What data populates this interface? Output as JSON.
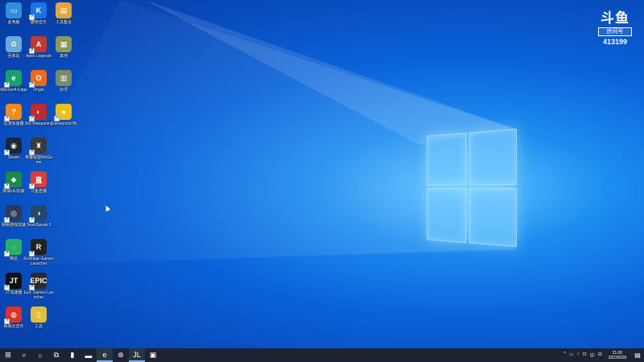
{
  "desktop": {
    "icons": [
      {
        "name": "this-pc",
        "label": "此电脑",
        "glyph": "▭",
        "color": "#2d8de0",
        "col": 0,
        "row": 0,
        "shortcut": false
      },
      {
        "name": "kugou",
        "label": "酷狗音乐",
        "glyph": "K",
        "color": "#1a73e8",
        "col": 1,
        "row": 0,
        "shortcut": true
      },
      {
        "name": "folder-1",
        "label": "工具集合",
        "glyph": "▤",
        "color": "#e0a83a",
        "col": 2,
        "row": 0,
        "shortcut": false
      },
      {
        "name": "recycle-bin",
        "label": "回收站",
        "glyph": "♻",
        "color": "#6aa9d8",
        "col": 0,
        "row": 1,
        "shortcut": false
      },
      {
        "name": "apex",
        "label": "Apex Legends",
        "glyph": "A",
        "color": "#c0392b",
        "col": 1,
        "row": 1,
        "shortcut": true
      },
      {
        "name": "folder-2",
        "label": "其他",
        "glyph": "▦",
        "color": "#8a9a5b",
        "col": 2,
        "row": 1,
        "shortcut": false
      },
      {
        "name": "edge",
        "label": "Microsoft Edge",
        "glyph": "e",
        "color": "#1aa06d",
        "col": 0,
        "row": 2,
        "shortcut": true
      },
      {
        "name": "origin",
        "label": "Origin",
        "glyph": "O",
        "color": "#f06a1a",
        "col": 1,
        "row": 2,
        "shortcut": true
      },
      {
        "name": "folder-3",
        "label": "杂项",
        "glyph": "▥",
        "color": "#7a8a6a",
        "col": 2,
        "row": 2,
        "shortcut": false
      },
      {
        "name": "app-orange",
        "label": "迅游加速器",
        "glyph": "?",
        "color": "#f08a1a",
        "col": 0,
        "row": 3,
        "shortcut": true
      },
      {
        "name": "wot",
        "label": "360 Wargaming",
        "glyph": "◐",
        "color": "#c02a2a",
        "col": 1,
        "row": 3,
        "shortcut": true
      },
      {
        "name": "app-yellow",
        "label": "TranslucentTB",
        "glyph": "●",
        "color": "#e8c21a",
        "col": 2,
        "row": 3,
        "shortcut": true
      },
      {
        "name": "steam",
        "label": "Steam",
        "glyph": "◉",
        "color": "#1b2838",
        "col": 0,
        "row": 4,
        "shortcut": true
      },
      {
        "name": "game-1",
        "label": "英雄联盟WeGame",
        "glyph": "♜",
        "color": "#3a3a3a",
        "col": 1,
        "row": 4,
        "shortcut": true
      },
      {
        "name": "app-green",
        "label": "网易UU加速",
        "glyph": "◆",
        "color": "#1a8a4a",
        "col": 0,
        "row": 5,
        "shortcut": true
      },
      {
        "name": "app-red-tv",
        "label": "斗鱼直播",
        "glyph": "直",
        "color": "#e03a3a",
        "col": 1,
        "row": 5,
        "shortcut": true
      },
      {
        "name": "app-dark-1",
        "label": "网易游戏加速",
        "glyph": "◎",
        "color": "#2a3a5a",
        "col": 0,
        "row": 6,
        "shortcut": true
      },
      {
        "name": "teamspeak",
        "label": "TeamSpeak 3",
        "glyph": "◑",
        "color": "#24476b",
        "col": 1,
        "row": 6,
        "shortcut": true
      },
      {
        "name": "wechat",
        "label": "微信",
        "glyph": "◌",
        "color": "#2aae67",
        "col": 0,
        "row": 7,
        "shortcut": true
      },
      {
        "name": "rockstar",
        "label": "Rockstar Games Launcher",
        "glyph": "R",
        "color": "#222",
        "col": 1,
        "row": 7,
        "shortcut": true
      },
      {
        "name": "app-jt",
        "label": "JT加速器",
        "glyph": "JT",
        "color": "#111",
        "col": 0,
        "row": 8,
        "shortcut": true
      },
      {
        "name": "epic",
        "label": "Epic Games Launcher",
        "glyph": "EPIC",
        "color": "#2a2a2a",
        "col": 1,
        "row": 8,
        "shortcut": true
      },
      {
        "name": "netease-music",
        "label": "网易云音乐",
        "glyph": "◍",
        "color": "#d8322a",
        "col": 0,
        "row": 9,
        "shortcut": true
      },
      {
        "name": "folder-4",
        "label": "工具",
        "glyph": "▯",
        "color": "#e0c03a",
        "col": 1,
        "row": 9,
        "shortcut": false
      }
    ]
  },
  "watermark": {
    "logo": "斗鱼",
    "room_label": "房间号",
    "room_id": "413199"
  },
  "taskbar": {
    "items": [
      {
        "name": "start-icon",
        "glyph": "⊞",
        "active": false
      },
      {
        "name": "search-icon",
        "glyph": "⌕",
        "active": false
      },
      {
        "name": "cortana-icon",
        "glyph": "○",
        "active": false
      },
      {
        "name": "task-view-icon",
        "glyph": "⧉",
        "active": false
      },
      {
        "name": "file-icon",
        "glyph": "▮",
        "active": false
      },
      {
        "name": "folder-icon",
        "glyph": "▬",
        "active": false
      },
      {
        "name": "edge-taskbar-icon",
        "glyph": "e",
        "active": true
      },
      {
        "name": "gamepad-icon",
        "glyph": "⊛",
        "active": false
      },
      {
        "name": "jt-taskbar-icon",
        "glyph": "JL",
        "active": true
      },
      {
        "name": "orange-app-taskbar-icon",
        "glyph": "▣",
        "active": false
      }
    ],
    "tray": [
      "^",
      "▭",
      "♪",
      "⊡",
      "中",
      "⊟"
    ],
    "time": "21:00",
    "date": "2022/6/28"
  }
}
